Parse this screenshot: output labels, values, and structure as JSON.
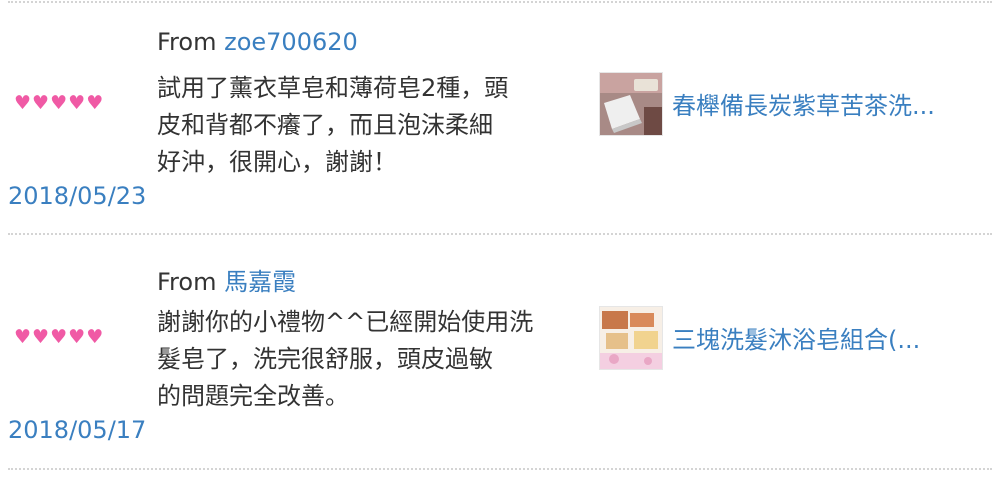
{
  "reviews": [
    {
      "from_label": "From",
      "username": "zoe700620",
      "rating": 5,
      "rating_glyph": "♥",
      "comment_lines": [
        "試用了薰衣草皂和薄荷皂2種，頭",
        "皮和背都不癢了，而且泡沫柔細",
        "好沖，很開心，謝謝！"
      ],
      "date": "2018/05/23",
      "product_name": "春櫸備長炭紫草苦茶洗..."
    },
    {
      "from_label": "From",
      "username": "馬嘉霞",
      "rating": 5,
      "rating_glyph": "♥",
      "comment_lines": [
        "謝謝你的小禮物^^已經開始使用洗",
        "髮皂了，洗完很舒服，頭皮過敏",
        "的問題完全改善。"
      ],
      "date": "2018/05/17",
      "product_name": "三塊洗髮沐浴皂組合(..."
    }
  ],
  "colors": {
    "heart": "#f05aa5",
    "link": "#3a7fc0",
    "text": "#333333",
    "divider": "#d4d4d4"
  }
}
